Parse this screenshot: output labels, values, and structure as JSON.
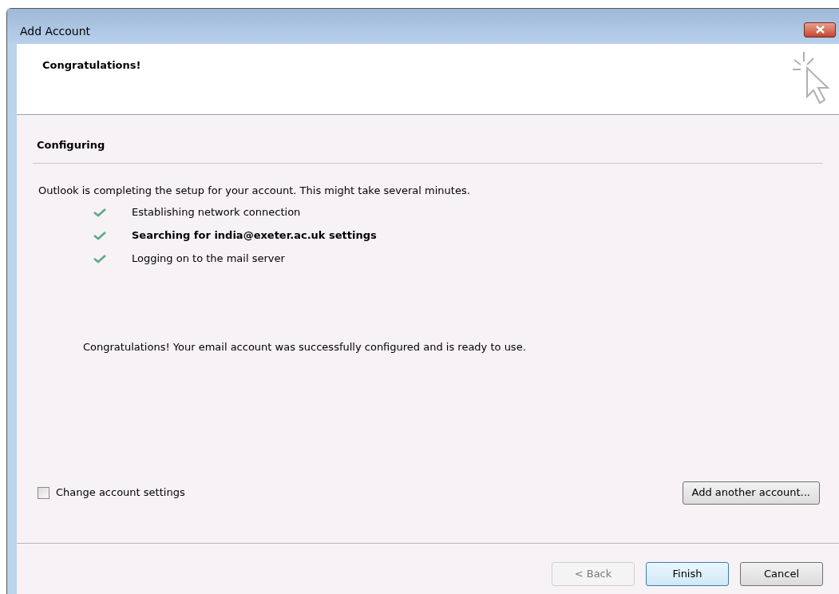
{
  "window": {
    "title": "Add Account"
  },
  "header": {
    "title": "Congratulations!"
  },
  "section": {
    "title": "Configuring"
  },
  "intro": "Outlook is completing the setup for your account. This might take several minutes.",
  "steps": [
    {
      "label": "Establishing network connection",
      "done": true,
      "current": false
    },
    {
      "label": "Searching for india@exeter.ac.uk settings",
      "done": true,
      "current": true
    },
    {
      "label": "Logging on to the mail server",
      "done": true,
      "current": false
    }
  ],
  "message": "Congratulations! Your email account was successfully configured and is ready to use.",
  "change_settings": {
    "label": "Change account settings",
    "checked": false
  },
  "add_another": {
    "label": "Add another account..."
  },
  "buttons": [
    {
      "label": "< Back",
      "disabled": true,
      "default": false
    },
    {
      "label": "Finish",
      "disabled": false,
      "default": true
    },
    {
      "label": "Cancel",
      "disabled": false,
      "default": false
    }
  ]
}
